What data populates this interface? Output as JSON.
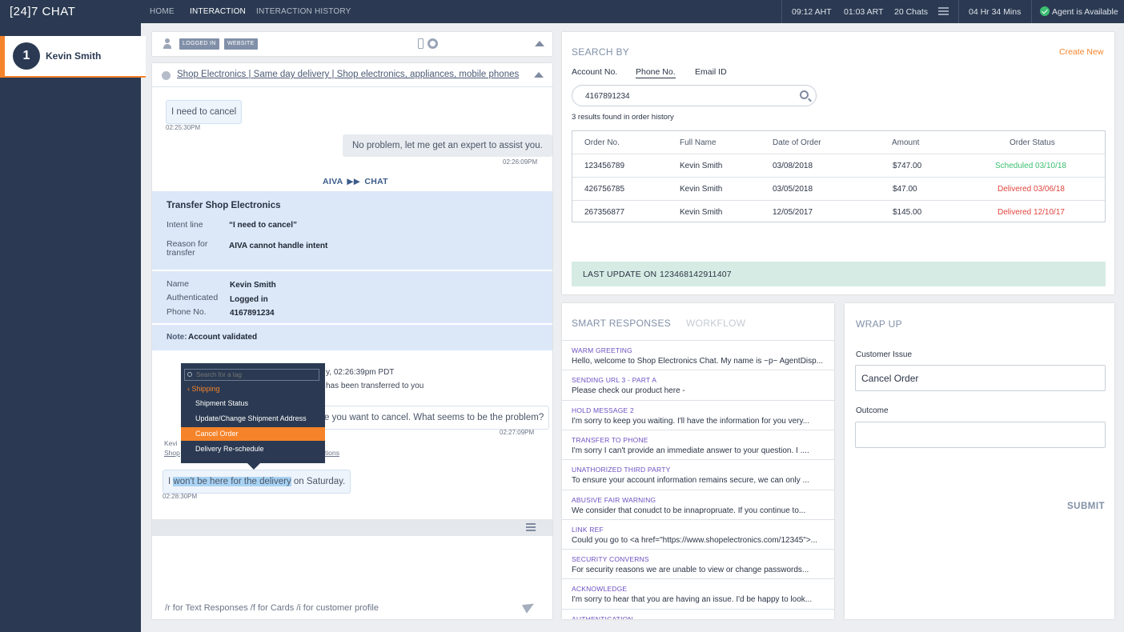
{
  "app": {
    "brand": "[24]7 CHAT",
    "nav": [
      "HOME",
      "INTERACTION",
      "INTERACTION HISTORY"
    ],
    "stats": {
      "aht": "09:12 AHT",
      "art": "01:03 ART",
      "chats": "20 Chats",
      "login_time": "04 Hr 34 Mins",
      "status": "Agent is Available"
    },
    "colors": {
      "accent": "#f5832a",
      "navy": "#2b3a52",
      "available": "#3cbf72"
    }
  },
  "sidebar": {
    "chats": [
      {
        "number": "1",
        "name": "Kevin Smith"
      }
    ]
  },
  "customer_bar": {
    "badges": [
      "LOGGED IN",
      "WEBSITE"
    ],
    "icons": [
      "person-icon",
      "phone-icon",
      "chrome-icon",
      "chevron-up-icon"
    ]
  },
  "chat": {
    "site_title": "Shop Electronics | Same day delivery | Shop electronics, appliances, mobile phones",
    "msg1": {
      "text": "I need to cancel",
      "time": "02:25:30PM"
    },
    "msg2": {
      "text": "No problem, let me get an expert to assist you.",
      "time": "02:26:09PM"
    },
    "handoff": {
      "from": "AIVA",
      "to": "CHAT"
    },
    "transfer": {
      "title": "Transfer Shop Electronics",
      "intent_label": "Intent line",
      "intent_value": "“I need to cancel”",
      "reason_label_1": "Reason for",
      "reason_label_2": "transfer",
      "reason_value": "AIVA cannot handle intent"
    },
    "customer": {
      "name_label": "Name",
      "name_value": "Kevin Smith",
      "auth_label": "Authenticated",
      "auth_value": "Logged in",
      "phone_label": "Phone No.",
      "phone_value": "4167891234"
    },
    "note": {
      "label": "Note:",
      "text": "Account validated"
    },
    "system_line_1": "y, 02:26:39pm PDT",
    "system_line_2": "has been transferred to you",
    "agent_msg": {
      "text": "e you want to cancel. What seems to be the problem?",
      "time": "02:27:09PM"
    },
    "agent_frag_1": "Kevi",
    "agent_frag_2": "Shop",
    "agent_frag_3": "tions",
    "msg3": {
      "pre": "I ",
      "selected": "won't be here for the delivery",
      "post": " on Saturday.",
      "time": "02:28:30PM"
    },
    "tag_menu": {
      "placeholder": "Search for a tag",
      "back": "Shipping",
      "items": [
        "Shipment Status",
        "Update/Change Shipment Address",
        "Cancel Order",
        "Delivery Re-schedule"
      ],
      "active_index": 2
    },
    "composer_hint": "/r for Text Responses  /f for Cards  /i for customer profile"
  },
  "search": {
    "title": "SEARCH BY",
    "create_new": "Create New",
    "tabs": [
      "Account No.",
      "Phone No.",
      "Email ID"
    ],
    "active_tab": "Phone No.",
    "query": "4167891234",
    "results_text": "3 results found in order history",
    "columns": [
      "Order No.",
      "Full Name",
      "Date of Order",
      "Amount",
      "Order Status"
    ],
    "rows": [
      {
        "order": "123456789",
        "name": "Kevin Smith",
        "date": "03/08/2018",
        "amount": "$747.00",
        "status": "Scheduled 03/10/18",
        "status_color": "#3cbf72"
      },
      {
        "order": "426756785",
        "name": "Kevin Smith",
        "date": "03/05/2018",
        "amount": "$47.00",
        "status": "Delivered 03/06/18",
        "status_color": "#e0443e"
      },
      {
        "order": "267356877",
        "name": "Kevin Smith",
        "date": "12/05/2017",
        "amount": "$145.00",
        "status": "Delivered 12/10/17",
        "status_color": "#e0443e"
      }
    ],
    "last_update_label": "LAST UPDATE ON",
    "last_update_value": "123468142911407"
  },
  "smart": {
    "tabs": [
      "SMART RESPONSES",
      "WORKFLOW"
    ],
    "items": [
      {
        "title": "WARM GREETING",
        "text": "Hello, welcome to Shop Electronics Chat. My name is ~p~ AgentDisp..."
      },
      {
        "title": "SENDING URL 3 - PART A",
        "text": "Please check our product here -"
      },
      {
        "title": "HOLD MESSAGE 2",
        "text": "I'm sorry to keep you waiting. I'll have the information for you very..."
      },
      {
        "title": "TRANSFER TO PHONE",
        "text": "I'm sorry I can't provide an immediate answer to your question. I ...."
      },
      {
        "title": "UNATHORIZED THIRD PARTY",
        "text": "To ensure your account information remains secure, we can only ..."
      },
      {
        "title": "ABUSIVE FAIR WARNING",
        "text": "We consider that conudct to be innapropruate. If you continue to..."
      },
      {
        "title": "LINK REF",
        "text": "Could you go to <a href=\"https://www.shopelectronics.com/12345\">..."
      },
      {
        "title": "SECURITY CONVERNS",
        "text": "For security reasons we are unable to view or change passwords..."
      },
      {
        "title": "ACKNOWLEDGE",
        "text": "I'm sorry to hear that you are having an issue. I'd be happy to look..."
      },
      {
        "title": "AUTHENTICATION",
        "text": ""
      }
    ]
  },
  "wrap": {
    "title": "WRAP UP",
    "issue_label": "Customer Issue",
    "issue_value": "Cancel Order",
    "outcome_label": "Outcome",
    "outcome_value": "",
    "submit": "SUBMIT"
  }
}
